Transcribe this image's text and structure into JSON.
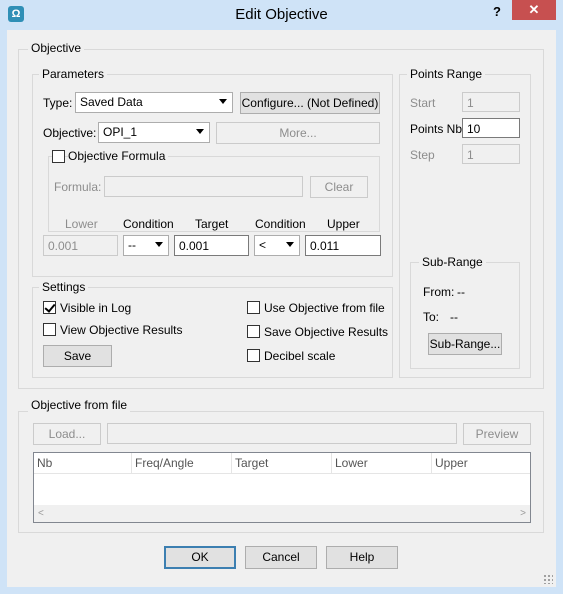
{
  "window": {
    "title": "Edit Objective",
    "help_symbol": "?",
    "close_symbol": "✕",
    "app_icon_glyph": "Ω"
  },
  "objective_group": {
    "label": "Objective"
  },
  "parameters": {
    "label": "Parameters",
    "type_label": "Type:",
    "type_value": "Saved Data",
    "configure_button": "Configure... (Not Defined)",
    "objective_label": "Objective:",
    "objective_value": "OPI_1",
    "more_button": "More...",
    "formula_checkbox": "Objective Formula",
    "formula_checked": false,
    "formula_label": "Formula:",
    "formula_value": "",
    "clear_button": "Clear",
    "col_lower": "Lower",
    "col_condition1": "Condition",
    "col_target": "Target",
    "col_condition2": "Condition",
    "col_upper": "Upper",
    "lower_value": "0.001",
    "condition1_value": "--",
    "target_value": "0.001",
    "condition2_value": "<",
    "upper_value": "0.011"
  },
  "points_range": {
    "label": "Points Range",
    "start_label": "Start",
    "start_value": "1",
    "points_nb_label": "Points Nb",
    "points_nb_value": "10",
    "step_label": "Step",
    "step_value": "1",
    "sub_range": {
      "label": "Sub-Range",
      "from_label": "From:",
      "from_value": "--",
      "to_label": "To:",
      "to_value": "--",
      "button": "Sub-Range..."
    }
  },
  "settings": {
    "label": "Settings",
    "visible_in_log": "Visible in Log",
    "visible_in_log_checked": true,
    "view_objective_results": "View Objective Results",
    "view_objective_results_checked": false,
    "save_button": "Save",
    "use_objective_from_file": "Use Objective from file",
    "use_objective_from_file_checked": false,
    "save_objective_results": "Save Objective Results",
    "save_objective_results_checked": false,
    "decibel_scale": "Decibel scale",
    "decibel_scale_checked": false
  },
  "objective_from_file": {
    "label": "Objective from file",
    "load_button": "Load...",
    "path_value": "",
    "preview_button": "Preview",
    "columns": [
      "Nb",
      "Freq/Angle",
      "Target",
      "Lower",
      "Upper"
    ],
    "scroll_left": "<",
    "scroll_right": ">"
  },
  "footer": {
    "ok": "OK",
    "cancel": "Cancel",
    "help": "Help"
  }
}
